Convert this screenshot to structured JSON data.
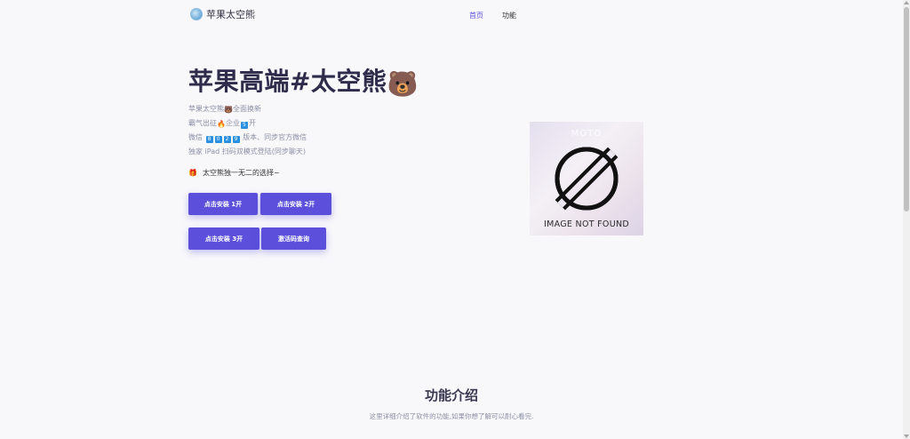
{
  "nav": {
    "brand": "苹果太空熊",
    "links": [
      {
        "label": "首页",
        "active": true
      },
      {
        "label": "功能",
        "active": false
      }
    ]
  },
  "hero": {
    "title": "苹果高端#太空熊",
    "title_emoji": "🐻",
    "lines": [
      {
        "before": "苹果太空熊",
        "emoji": "🐻",
        "after": "全面换新"
      },
      {
        "before": "霸气出征",
        "emoji": "🔥",
        "middle": "企业",
        "badge": "5",
        "after": "开"
      },
      {
        "before": "微信",
        "badges": [
          "8",
          "0",
          "2",
          "9"
        ],
        "after": "版本、同步官方微信"
      },
      {
        "text": "独家 iPad 扫码双模式登陆(同步聊天)"
      }
    ],
    "tagline": {
      "emoji": "🎁",
      "text": "太空熊独一无二的选择~"
    },
    "buttons": [
      "点击安装 1开",
      "点击安装 2开",
      "点击安装 3开",
      "激活码查询"
    ]
  },
  "image": {
    "watermark": "MOTO",
    "placeholder_text": "IMAGE NOT FOUND"
  },
  "features": {
    "title": "功能介绍",
    "subtitle": "这里详细介绍了软件的功能,如果你想了解可以耐心看完."
  },
  "colors": {
    "accent": "#5b4fdb",
    "badge": "#2a90e0",
    "background": "#f8f8fb"
  }
}
